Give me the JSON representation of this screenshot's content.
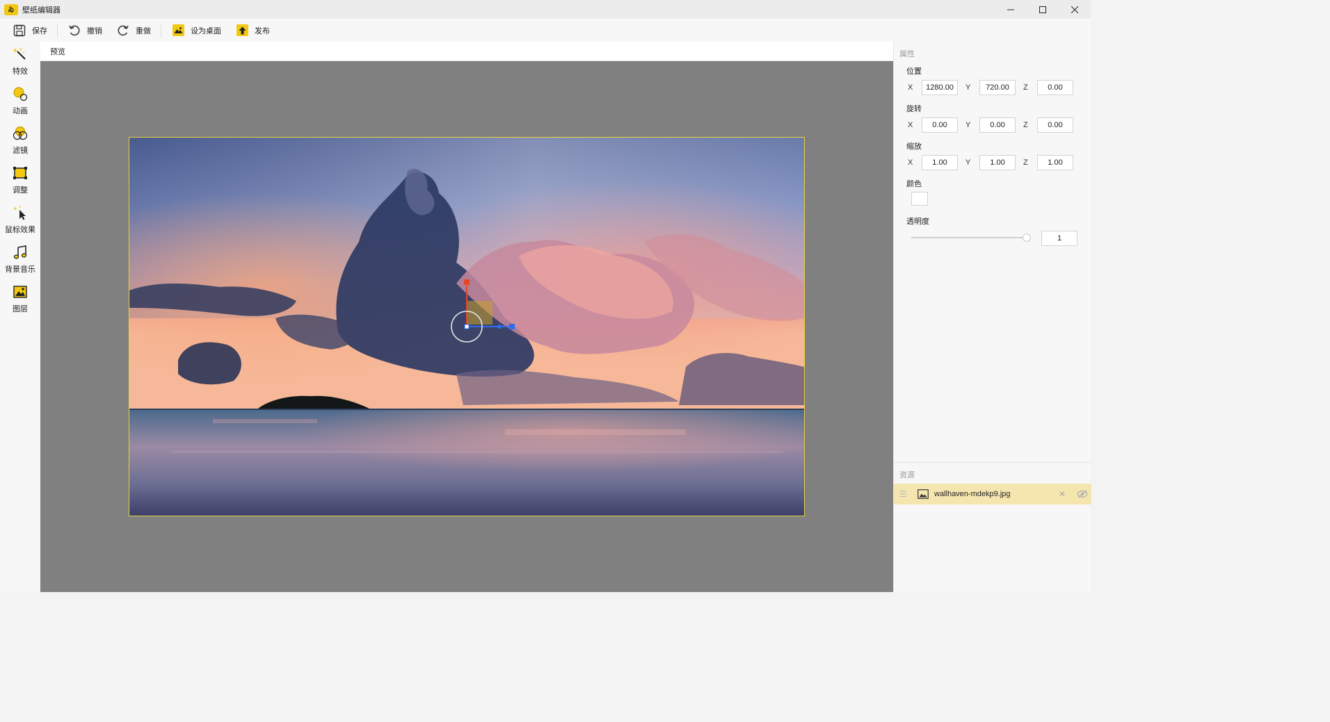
{
  "app": {
    "title": "壁纸编辑器",
    "logo_text": "ゐ"
  },
  "window_controls": {
    "minimize": "—",
    "maximize": "☐",
    "close": "✕"
  },
  "toolbar": {
    "save": "保存",
    "undo": "撤销",
    "redo": "重做",
    "set_desktop": "设为桌面",
    "publish": "发布"
  },
  "sidebar": {
    "items": [
      {
        "label": "特效",
        "icon": "magic-wand-icon"
      },
      {
        "label": "动画",
        "icon": "animation-circles-icon"
      },
      {
        "label": "滤镜",
        "icon": "filter-circles-icon"
      },
      {
        "label": "调整",
        "icon": "adjust-frame-icon"
      },
      {
        "label": "鼠标效果",
        "icon": "cursor-sparkle-icon"
      },
      {
        "label": "背景音乐",
        "icon": "music-note-icon"
      },
      {
        "label": "图层",
        "icon": "image-layer-icon"
      }
    ]
  },
  "preview": {
    "header": "预览"
  },
  "properties": {
    "section_title": "属性",
    "position": {
      "label": "位置",
      "x": "1280.00",
      "y": "720.00",
      "z": "0.00"
    },
    "rotation": {
      "label": "旋转",
      "x": "0.00",
      "y": "0.00",
      "z": "0.00"
    },
    "scale": {
      "label": "缩放",
      "x": "1.00",
      "y": "1.00",
      "z": "1.00"
    },
    "color": {
      "label": "颜色",
      "value": "#ffffff"
    },
    "opacity": {
      "label": "透明度",
      "value": "1",
      "slider_fraction": 1.0
    },
    "axis_x": "X",
    "axis_y": "Y",
    "axis_z": "Z"
  },
  "resources": {
    "section_title": "资源",
    "items": [
      {
        "name": "wallhaven-mdekp9.jpg",
        "selected": true
      }
    ]
  },
  "colors": {
    "accent": "#f2c811",
    "canvas_border": "#e7d43c",
    "selected_row": "#f5e6b0",
    "preview_bg": "#808080"
  }
}
